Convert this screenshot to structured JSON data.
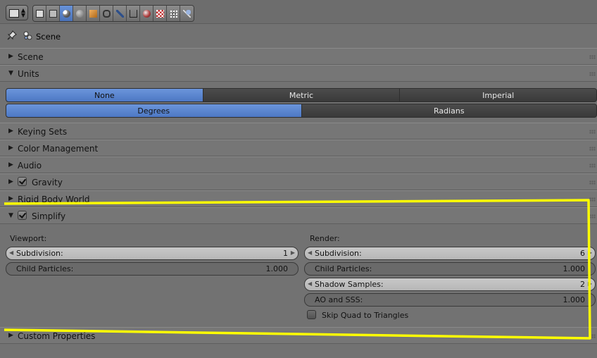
{
  "context": {
    "scene_label": "Scene"
  },
  "panels": {
    "scene": "Scene",
    "units": "Units",
    "keying_sets": "Keying Sets",
    "color_management": "Color Management",
    "audio": "Audio",
    "gravity": "Gravity",
    "rigid_body_world": "Rigid Body World",
    "simplify": "Simplify",
    "custom_properties": "Custom Properties"
  },
  "units": {
    "system": {
      "options": [
        "None",
        "Metric",
        "Imperial"
      ],
      "selected": "None"
    },
    "rotation": {
      "options": [
        "Degrees",
        "Radians"
      ],
      "selected": "Degrees"
    }
  },
  "simplify": {
    "viewport_label": "Viewport:",
    "render_label": "Render:",
    "viewport": {
      "subdivision": {
        "label": "Subdivision:",
        "value": "1"
      },
      "child_particles": {
        "label": "Child Particles:",
        "value": "1.000"
      }
    },
    "render": {
      "subdivision": {
        "label": "Subdivision:",
        "value": "6"
      },
      "child_particles": {
        "label": "Child Particles:",
        "value": "1.000"
      },
      "shadow_samples": {
        "label": "Shadow Samples:",
        "value": "2"
      },
      "ao_and_sss": {
        "label": "AO and SSS:",
        "value": "1.000"
      },
      "skip_quad_to_triangles": {
        "label": "Skip Quad to Triangles",
        "checked": false
      }
    }
  },
  "icons": {
    "properties_tabs": [
      "render-icon",
      "render-layers-icon",
      "scene-icon",
      "world-icon",
      "object-icon",
      "constraints-icon",
      "modifiers-icon",
      "data-icon",
      "material-icon",
      "texture-icon",
      "particles-icon",
      "physics-icon"
    ],
    "active_tab": "scene-icon"
  },
  "colors": {
    "selected": "#5680c9",
    "annotation": "#ffff00"
  }
}
